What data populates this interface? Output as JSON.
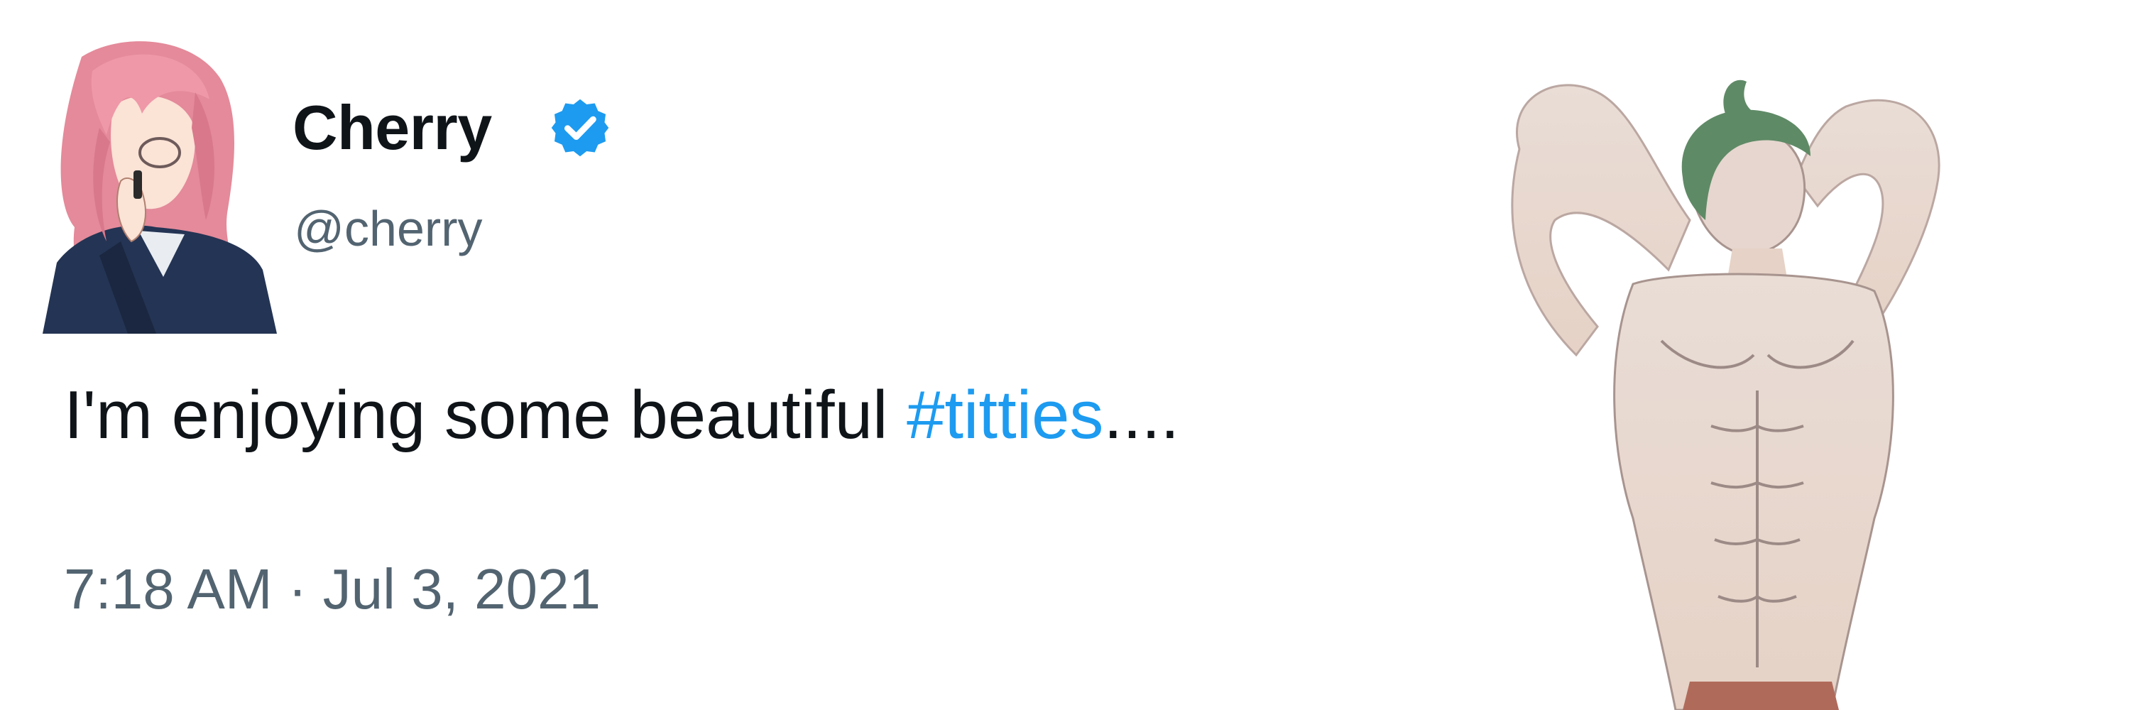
{
  "tweet": {
    "display_name": "Cherry",
    "handle": "@cherry",
    "verified": true,
    "verified_icon": "verified-badge-icon",
    "text_before": "I'm enjoying some beautiful ",
    "hashtag": "#titties",
    "text_after": "....",
    "timestamp": "7:18 AM · Jul 3, 2021"
  },
  "colors": {
    "text": "#0f1419",
    "secondary": "#536471",
    "link": "#1d9bf0",
    "verified": "#1d9bf0",
    "background": "#ffffff"
  }
}
